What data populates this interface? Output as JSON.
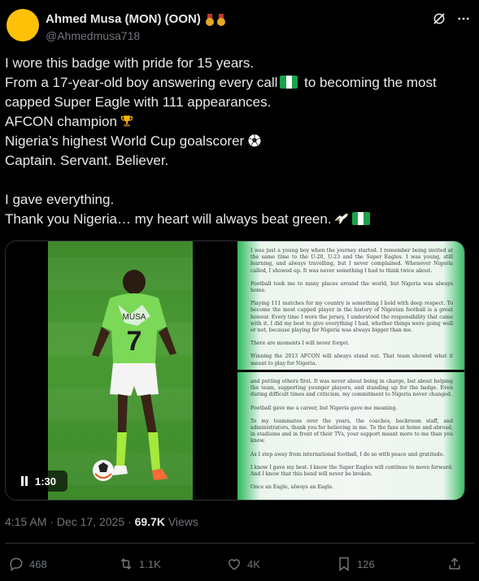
{
  "author": {
    "display_name": "Ahmed Musa (MON) (OON)",
    "handle": "@Ahmedmusa718",
    "avatar_color": "#ffc107"
  },
  "header_icons": [
    "grok-icon",
    "more-icon"
  ],
  "tweet": {
    "lines": [
      "I wore this badge with pride for 15 years.",
      "From a 17-year-old boy answering every call",
      "to becoming the most",
      "capped Super Eagle with 111 appearances.",
      "AFCON champion",
      "Nigeria’s highest World Cup goalscorer",
      "Captain. Servant. Believer.",
      "I gave everything.",
      "Thank you Nigeria… my heart will always beat green."
    ]
  },
  "media": {
    "video": {
      "duration": "1:30",
      "jersey_name": "MUSA",
      "jersey_number": "7"
    },
    "letter_top": [
      "I was just a young boy when the journey started. I remember being invited at the same time to the U-20, U-23 and the Super Eagles. I was young, still learning, and always travelling, but I never complained. Whenever Nigeria called, I showed up. It was never something I had to think twice about.",
      "Football took me to many places around the world, but Nigeria was always home.",
      "Playing 111 matches for my country is something I hold with deep respect. To become the most capped player in the history of Nigerian football is a great honour. Every time I wore the jersey, I understood the responsibility that came with it. I did my best to give everything I had, whether things were going well or not, because playing for Nigeria was always bigger than me.",
      "There are moments I will never forget.",
      "Winning the 2013 AFCON will always stand out. That team showed what it meant to play for Nigeria."
    ],
    "letter_bottom": [
      "and putting others first. It was never about being in charge, but about helping the team, supporting younger players, and standing up for the badge. Even during difficult times and criticism, my commitment to Nigeria never changed.",
      "Football gave me a career, but Nigeria gave me meaning.",
      "To my teammates over the years, the coaches, backroom staff, and administrators, thank you for believing in me. To the fans at home and abroad, in stadiums and in front of their TVs, your support meant more to me than you know.",
      "As I step away from international football, I do so with peace and gratitude.",
      "I know I gave my best. I know the Super Eagles will continue to move forward. And I know that this bond will never be broken.",
      "Once an Eagle, always an Eagle."
    ]
  },
  "meta": {
    "time": "4:15 AM",
    "separator": "·",
    "date": "Dec 17, 2025",
    "views_count": "69.7K",
    "views_label": "Views"
  },
  "actions": {
    "replies": "468",
    "reposts": "1.1K",
    "likes": "4K",
    "bookmarks": "126"
  },
  "colors": {
    "background": "#000000",
    "text": "#e7e9ea",
    "muted": "#71767b",
    "nigeria_green": "#19a34a"
  }
}
